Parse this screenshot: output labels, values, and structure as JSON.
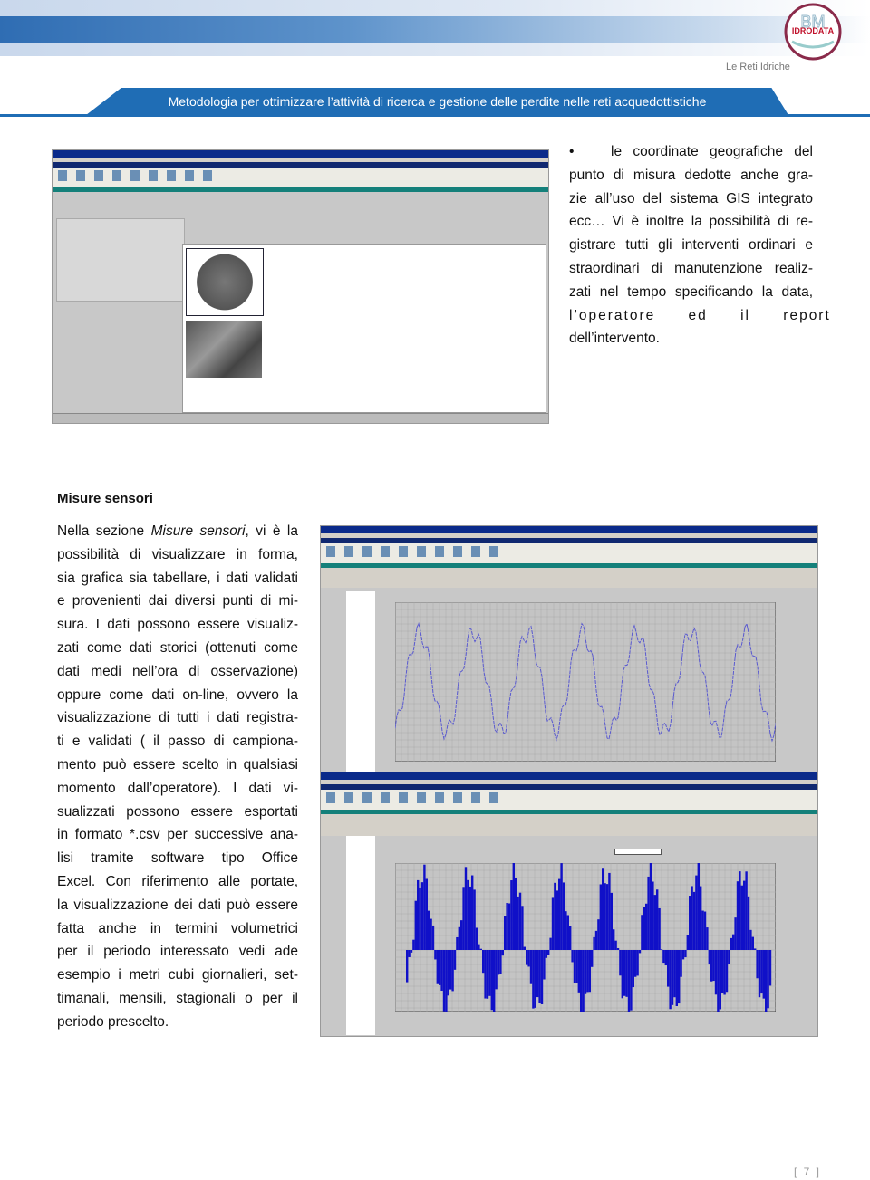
{
  "header": {
    "logo_text": "BM IDRODATA",
    "tagline": "Le Reti Idriche",
    "title": "Metodologia per ottimizzare l’attività  di ricerca e gestione delle perdite nelle reti acquedottistiche",
    "accent_color": "#1f6db5"
  },
  "top_right": {
    "bullet": "•",
    "lines": [
      "le coordinate geografiche del",
      "punto di misura dedotte anche gra-",
      "zie all’uso del sistema GIS integrato",
      "ecc…  Vi è inoltre la possibilità di re-",
      "gistrare tutti gli interventi ordinari e",
      "straordinari di manutenzione realiz-",
      "zati nel tempo specificando la data,",
      "l’operatore ed il report",
      "dell’intervento."
    ]
  },
  "section": {
    "title": "Misure sensori",
    "first_line": {
      "pre": "Nella sezione ",
      "italic": "Misure sensori",
      "post": ", vi è la"
    },
    "lines": [
      "possibilità di visualizzare in forma,",
      "sia grafica sia tabellare, i dati validati",
      "e provenienti dai diversi punti di mi-",
      "sura. I dati possono essere visualiz-",
      "zati come dati storici (ottenuti come",
      "dati medi nell’ora di osservazione)",
      "oppure come dati on-line, ovvero la",
      "visualizzazione di tutti i dati registra-",
      "ti e validati ( il passo di campiona-",
      "mento può essere scelto in qualsiasi",
      "momento dall’operatore). I dati vi-",
      "sualizzati possono essere esportati",
      "in formato *.csv per successive ana-",
      "lisi tramite software tipo Office",
      "Excel. Con riferimento alle portate,",
      "la visualizzazione dei dati può essere",
      "fatta anche in termini volumetrici",
      "per il periodo interessato vedi ade",
      "esempio i metri cubi giornalieri, set-",
      "timanali, mensili, stagionali o per il",
      "periodo prescelto."
    ]
  },
  "images": {
    "station_screenshot": "software screenshot: station details with inspection photos",
    "line_chart_screenshot": "software screenshot: sensor measurements line chart",
    "bar_chart_screenshot": "software screenshot: volumetric bar chart"
  },
  "footer": {
    "page_number": "[ 7 ]"
  }
}
